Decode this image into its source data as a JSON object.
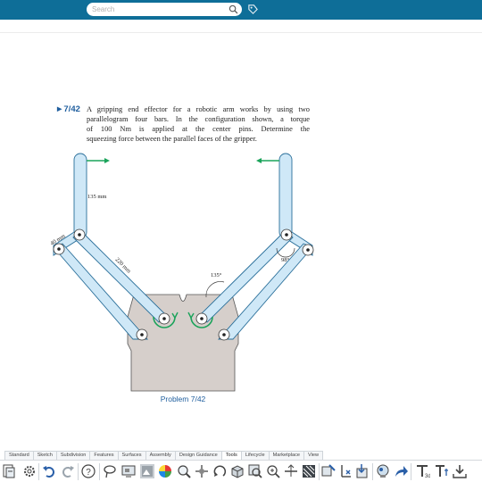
{
  "header": {
    "search_placeholder": "Search"
  },
  "problem": {
    "number": "►7/42",
    "lines": [
      "A gripping end effector for a robotic arm works by using two",
      "parallelogram four bars. In the configuration shown, a torque",
      "of 100 Nm is applied at the center pins. Determine the",
      "squeezing force between the parallel faces of the gripper."
    ],
    "dims": {
      "finger": "135 mm",
      "short_link": "40 mm",
      "long_link": "220 mm",
      "angle_top": "135°",
      "angle_small": "98°"
    },
    "caption": "Problem 7/42"
  },
  "tabs": [
    "Standard",
    "Sketch",
    "Subdivision",
    "Features",
    "Surfaces",
    "Assembly",
    "Design Guidance",
    "Tools",
    "Lifecycle",
    "Marketplace",
    "View"
  ],
  "active_tab": "Tools",
  "toolbar_icons": [
    "new-document-icon",
    "settings-icon",
    "undo-icon",
    "redo-icon",
    "help-icon",
    "lasso-icon",
    "display-panel-icon",
    "image-icon",
    "color-wheel-icon",
    "measure-icon",
    "move-icon",
    "rotate-icon",
    "render-icon",
    "zoom-window-icon",
    "magnify-icon",
    "section-icon",
    "pattern-icon",
    "decal-icon",
    "mate-icon",
    "import-icon",
    "appearance-icon",
    "share-icon",
    "text-icon",
    "dimension-icon",
    "download-icon"
  ],
  "colors": {
    "header": "#0e6e98",
    "link_fill": "#cfe8f7",
    "link_stroke": "#2a6f9a",
    "base_fill": "#d6cfcb",
    "arrow_green": "#1aa35a",
    "title_blue": "#1f5e9e"
  }
}
